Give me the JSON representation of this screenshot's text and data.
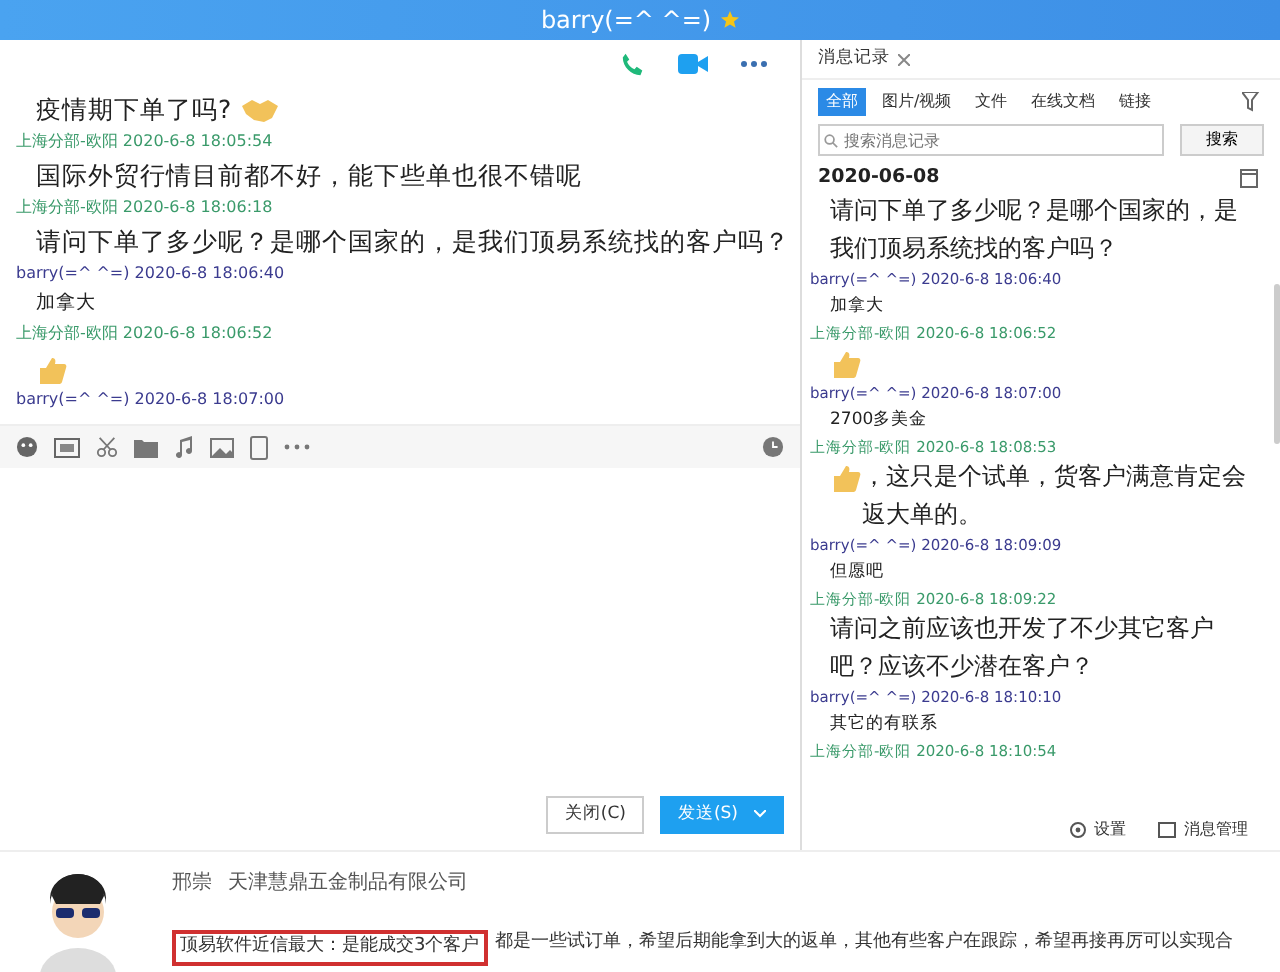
{
  "window": {
    "title": "barry(=^ ^=)"
  },
  "chat": {
    "messages": [
      {
        "kind": "text_icon",
        "text": "疫情期下单了吗?"
      },
      {
        "kind": "meta_other",
        "sender": "上海分部-欧阳",
        "time": "2020-6-8 18:05:54"
      },
      {
        "kind": "text",
        "text": "国际外贸行情目前都不好，能下些单也很不错呢"
      },
      {
        "kind": "meta_other",
        "sender": "上海分部-欧阳",
        "time": "2020-6-8 18:06:18"
      },
      {
        "kind": "text",
        "text": "请问下单了多少呢？是哪个国家的，是我们顶易系统找的客户吗？"
      },
      {
        "kind": "meta_self",
        "sender": "barry(=^ ^=)",
        "time": "2020-6-8 18:06:40"
      },
      {
        "kind": "small",
        "text": "加拿大"
      },
      {
        "kind": "meta_other",
        "sender": "上海分部-欧阳",
        "time": "2020-6-8 18:06:52"
      },
      {
        "kind": "thumb"
      },
      {
        "kind": "meta_self",
        "sender": "barry(=^ ^=)",
        "time": "2020-6-8 18:07:00"
      }
    ],
    "buttons": [
      {
        "label": "关闭(C)",
        "kind": "plain"
      },
      {
        "label": "发送(S)",
        "kind": "primary"
      }
    ]
  },
  "history": {
    "tab": "消息记录",
    "filters": [
      {
        "label": "全部",
        "selected": true
      },
      {
        "label": "图片/视频",
        "selected": false
      },
      {
        "label": "文件",
        "selected": false
      },
      {
        "label": "在线文档",
        "selected": false
      },
      {
        "label": "链接",
        "selected": false
      }
    ],
    "search": {
      "placeholder": "搜索消息记录",
      "button": "搜索"
    },
    "date": "2020-06-08",
    "messages": [
      {
        "kind": "text",
        "text": "请问下单了多少呢？是哪个国家的，是我们顶易系统找的客户吗？"
      },
      {
        "kind": "meta_self",
        "sender": "barry(=^ ^=)",
        "time": "2020-6-8 18:06:40"
      },
      {
        "kind": "small",
        "text": "加拿大"
      },
      {
        "kind": "meta_other",
        "sender": "上海分部-欧阳",
        "time": "2020-6-8 18:06:52"
      },
      {
        "kind": "thumb"
      },
      {
        "kind": "meta_self",
        "sender": "barry(=^ ^=)",
        "time": "2020-6-8 18:07:00"
      },
      {
        "kind": "small",
        "text": "2700多美金"
      },
      {
        "kind": "meta_other",
        "sender": "上海分部-欧阳",
        "time": "2020-6-8 18:08:53"
      },
      {
        "kind": "thumb_text",
        "text": "，这只是个试单，货客户满意肯定会返大单的。"
      },
      {
        "kind": "meta_self",
        "sender": "barry(=^ ^=)",
        "time": "2020-6-8 18:09:09"
      },
      {
        "kind": "small",
        "text": "但愿吧"
      },
      {
        "kind": "meta_other",
        "sender": "上海分部-欧阳",
        "time": "2020-6-8 18:09:22"
      },
      {
        "kind": "text",
        "text": "请问之前应该也开发了不少其它客户吧？应该不少潜在客户？"
      },
      {
        "kind": "meta_self",
        "sender": "barry(=^ ^=)",
        "time": "2020-6-8 18:10:10"
      },
      {
        "kind": "small",
        "text": "其它的有联系"
      },
      {
        "kind": "meta_other",
        "sender": "上海分部-欧阳",
        "time": "2020-6-8 18:10:54"
      }
    ],
    "footer": [
      "设置",
      "消息管理"
    ]
  },
  "testimonial": {
    "name": "邢崇",
    "company": "天津慧鼎五金制品有限公司",
    "highlight": "顶易软件近信最大：是能成交3个客户",
    "text": "都是一些试订单，希望后期能拿到大的返单，其他有些客户在跟踪，希望再接再厉可以实现合"
  }
}
